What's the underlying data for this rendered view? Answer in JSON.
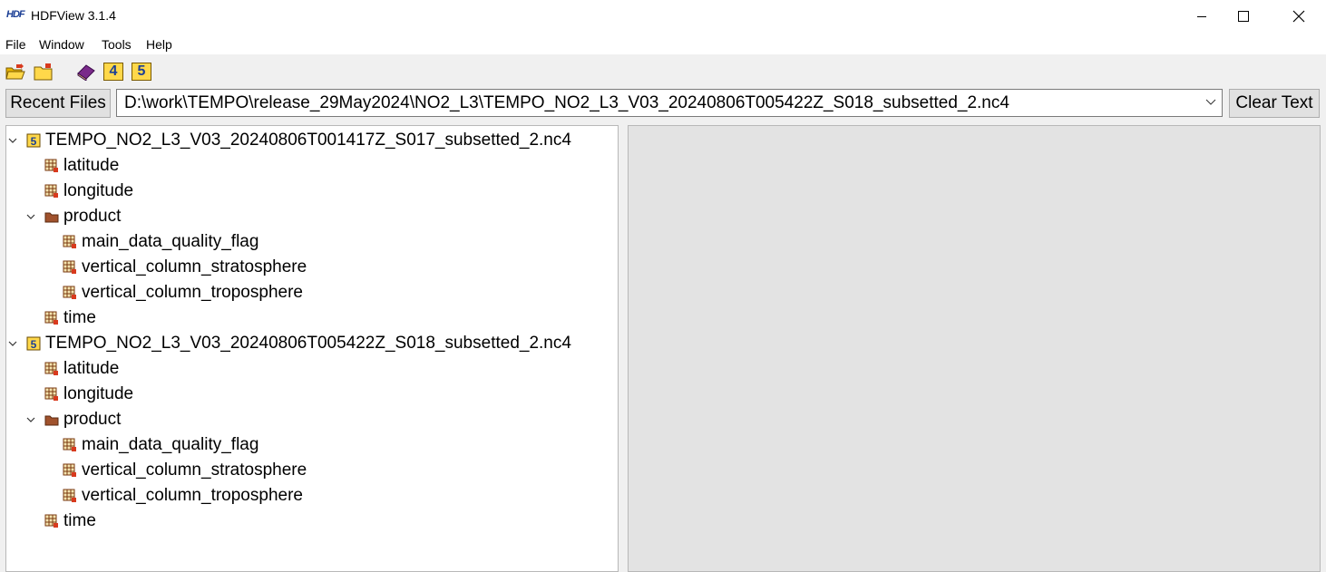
{
  "window": {
    "title": "HDFView 3.1.4",
    "logo_text": "HDF"
  },
  "menu": [
    "File",
    "Window",
    "Tools",
    "Help"
  ],
  "toolbar": {
    "icons": [
      "open-file-icon",
      "open-folder-icon",
      "help-book-icon",
      "hdf4-library-icon",
      "hdf5-library-icon"
    ],
    "hdf4_label": "4",
    "hdf5_label": "5"
  },
  "recent": {
    "button_label": "Recent Files",
    "path": "D:\\work\\TEMPO\\release_29May2024\\NO2_L3\\TEMPO_NO2_L3_V03_20240806T005422Z_S018_subsetted_2.nc4",
    "clear_label": "Clear Text"
  },
  "tree": [
    {
      "label": "TEMPO_NO2_L3_V03_20240806T001417Z_S017_subsetted_2.nc4",
      "type": "file",
      "level": 0,
      "expanded": true
    },
    {
      "label": "latitude",
      "type": "dataset",
      "level": 1
    },
    {
      "label": "longitude",
      "type": "dataset",
      "level": 1
    },
    {
      "label": "product",
      "type": "group",
      "level": 1,
      "expanded": true
    },
    {
      "label": "main_data_quality_flag",
      "type": "dataset",
      "level": 2
    },
    {
      "label": "vertical_column_stratosphere",
      "type": "dataset",
      "level": 2
    },
    {
      "label": "vertical_column_troposphere",
      "type": "dataset",
      "level": 2
    },
    {
      "label": "time",
      "type": "dataset",
      "level": 1
    },
    {
      "label": "TEMPO_NO2_L3_V03_20240806T005422Z_S018_subsetted_2.nc4",
      "type": "file",
      "level": 0,
      "expanded": true
    },
    {
      "label": "latitude",
      "type": "dataset",
      "level": 1
    },
    {
      "label": "longitude",
      "type": "dataset",
      "level": 1
    },
    {
      "label": "product",
      "type": "group",
      "level": 1,
      "expanded": true
    },
    {
      "label": "main_data_quality_flag",
      "type": "dataset",
      "level": 2
    },
    {
      "label": "vertical_column_stratosphere",
      "type": "dataset",
      "level": 2
    },
    {
      "label": "vertical_column_troposphere",
      "type": "dataset",
      "level": 2
    },
    {
      "label": "time",
      "type": "dataset",
      "level": 1
    }
  ]
}
